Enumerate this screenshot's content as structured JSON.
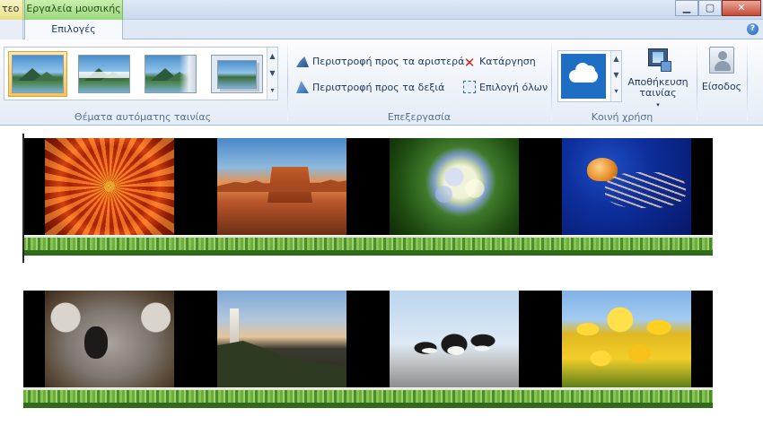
{
  "titlebar": {
    "context_tab_left": "τεο",
    "context_tab_music": "Εργαλεία μουσικής",
    "window_controls": {
      "minimize": "▁",
      "maximize": "▢",
      "close": "✕"
    }
  },
  "tabs": {
    "left_tab": "",
    "options_tab": "Επιλογές",
    "help_icon_symbol": "?"
  },
  "ribbon": {
    "themes_group": {
      "label": "Θέματα αυτόματης ταινίας",
      "selected_index": 0,
      "thumbnails": [
        "theme-1",
        "theme-2",
        "theme-3",
        "theme-4"
      ],
      "scroll": {
        "up": "▲",
        "down": "▼",
        "more": "▾"
      }
    },
    "editing_group": {
      "label": "Επεξεργασία",
      "rotate_left": "Περιστροφή προς τα αριστερά",
      "rotate_right": "Περιστροφή προς τα δεξιά",
      "remove": "Κατάργηση",
      "select_all": "Επιλογή όλων"
    },
    "sharing_group": {
      "label": "Κοινή χρήση",
      "service_icon": "onedrive-icon",
      "scroll": {
        "up": "▲",
        "down": "▼",
        "more": "▾"
      }
    },
    "save_movie": {
      "line1": "Αποθήκευση",
      "line2": "ταινίας",
      "caret": "▾"
    },
    "sign_in": {
      "label": "Είσοδος"
    }
  },
  "storyboard": {
    "rows": [
      {
        "photos": [
          "flower",
          "desert",
          "hydrangea",
          "jellyfish"
        ]
      },
      {
        "photos": [
          "koala",
          "lighthouse",
          "penguins",
          "tulips"
        ]
      }
    ]
  },
  "colors": {
    "music_tools_tab": "#9bd77c",
    "audio_track": "#6fae3e",
    "selected_theme": "#f7c55a",
    "onedrive_tile": "#1e6fc4"
  }
}
